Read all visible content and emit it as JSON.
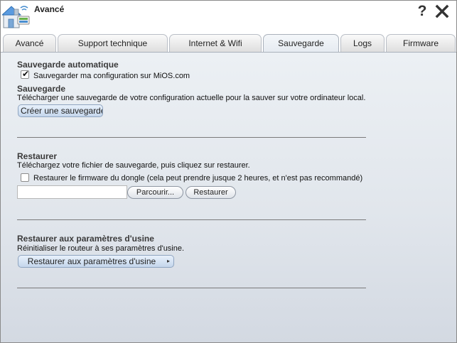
{
  "window": {
    "title": "Avancé"
  },
  "tabs": [
    {
      "label": "Avancé"
    },
    {
      "label": "Support technique"
    },
    {
      "label": "Internet & Wifi"
    },
    {
      "label": "Sauvegarde"
    },
    {
      "label": "Logs"
    },
    {
      "label": "Firmware"
    }
  ],
  "active_tab": "Sauvegarde",
  "auto_backup": {
    "heading": "Sauvegarde automatique",
    "checkbox_label": "Sauvegarder ma configuration sur MiOS.com",
    "checked": true
  },
  "backup": {
    "heading": "Sauvegarde",
    "description": "Télécharger une sauvegarde de votre configuration actuelle pour la sauver sur votre ordinateur local.",
    "button_label": "Créer une sauvegarde"
  },
  "restore": {
    "heading": "Restaurer",
    "description": "Téléchargez votre fichier de sauvegarde, puis cliquez sur restaurer.",
    "checkbox_label": "Restaurer le firmware du dongle (cela peut prendre jusque 2 heures, et n'est pas recommandé)",
    "checked": false,
    "file_value": "",
    "browse_label": "Parcourir...",
    "restore_label": "Restaurer"
  },
  "factory": {
    "heading": "Restaurer aux paramètres d'usine",
    "description": "Réinitialiser le routeur à ses paramètres d'usine.",
    "button_label": "Restaurer aux paramètres d'usine"
  },
  "icons": {
    "app": "house-network-icon",
    "help": "question-mark-icon",
    "close": "close-x-icon"
  }
}
